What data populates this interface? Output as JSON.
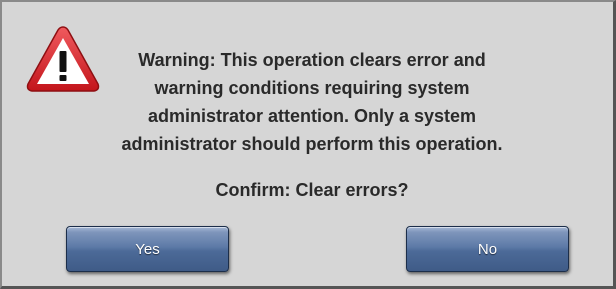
{
  "dialog": {
    "icon": "warning-triangle-icon",
    "message_lines": [
      "Warning: This operation clears error and",
      "warning conditions requiring system",
      "administrator attention. Only a system",
      "administrator should perform this operation."
    ],
    "confirm_text": "Confirm: Clear errors?",
    "buttons": {
      "yes_label": "Yes",
      "no_label": "No"
    },
    "colors": {
      "icon_red": "#d9262b",
      "button_blue": "#5d7aa7"
    }
  }
}
